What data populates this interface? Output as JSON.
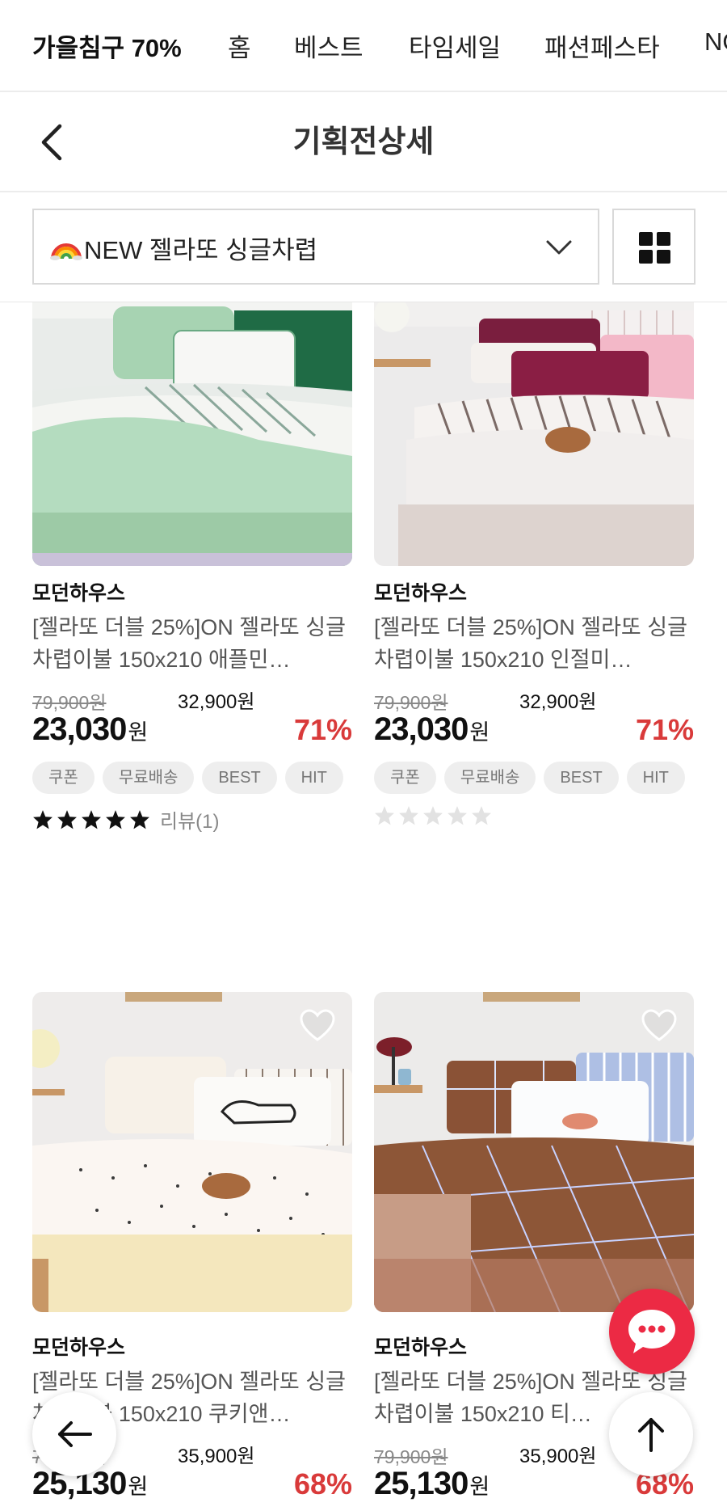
{
  "topnav": {
    "items": [
      "가을침구 70%",
      "홈",
      "베스트",
      "타임세일",
      "패션페스타",
      "NO"
    ]
  },
  "header": {
    "title": "기획전상세",
    "back_icon": "chevron-left-icon"
  },
  "filter": {
    "selected": "NEW 젤라또 싱글차렵",
    "selected_emoji": "rainbow",
    "grid_icon": "grid-view-icon"
  },
  "products": [
    {
      "brand": "모던하우스",
      "name": "[젤라또 더블 25%]ON 젤라또 싱글 차렵이불 150x210 애플민…",
      "orig_price": "79,900원",
      "coupon_price": "32,900원",
      "sale_price": "23,030",
      "won": "원",
      "discount": "71%",
      "tags": [
        "쿠폰",
        "무료배송",
        "BEST",
        "HIT"
      ],
      "rating": 5,
      "review": "리뷰(1)"
    },
    {
      "brand": "모던하우스",
      "name": "[젤라또 더블 25%]ON 젤라또 싱글 차렵이불 150x210 인절미…",
      "orig_price": "79,900원",
      "coupon_price": "32,900원",
      "sale_price": "23,030",
      "won": "원",
      "discount": "71%",
      "tags": [
        "쿠폰",
        "무료배송",
        "BEST",
        "HIT"
      ],
      "rating": 0,
      "review": ""
    },
    {
      "brand": "모던하우스",
      "name": "[젤라또 더블 25%]ON 젤라또 싱글 차렵이불 150x210 쿠키앤…",
      "orig_price": "79,900원",
      "coupon_price": "35,900원",
      "sale_price": "25,130",
      "won": "원",
      "discount": "68%"
    },
    {
      "brand": "모던하우스",
      "name": "[젤라또 더블 25%]ON 젤라또 싱글 차렵이불 150x210 티…",
      "orig_price": "79,900원",
      "coupon_price": "35,900원",
      "sale_price": "25,130",
      "won": "원",
      "discount": "68%"
    }
  ],
  "colors": {
    "accent_red": "#d93a3a",
    "chat_fab": "#ec2a44",
    "tag_bg": "#eeeeee"
  },
  "floating": {
    "back_icon": "arrow-left-icon",
    "top_icon": "arrow-up-icon",
    "chat_icon": "chat-bubble-icon"
  }
}
